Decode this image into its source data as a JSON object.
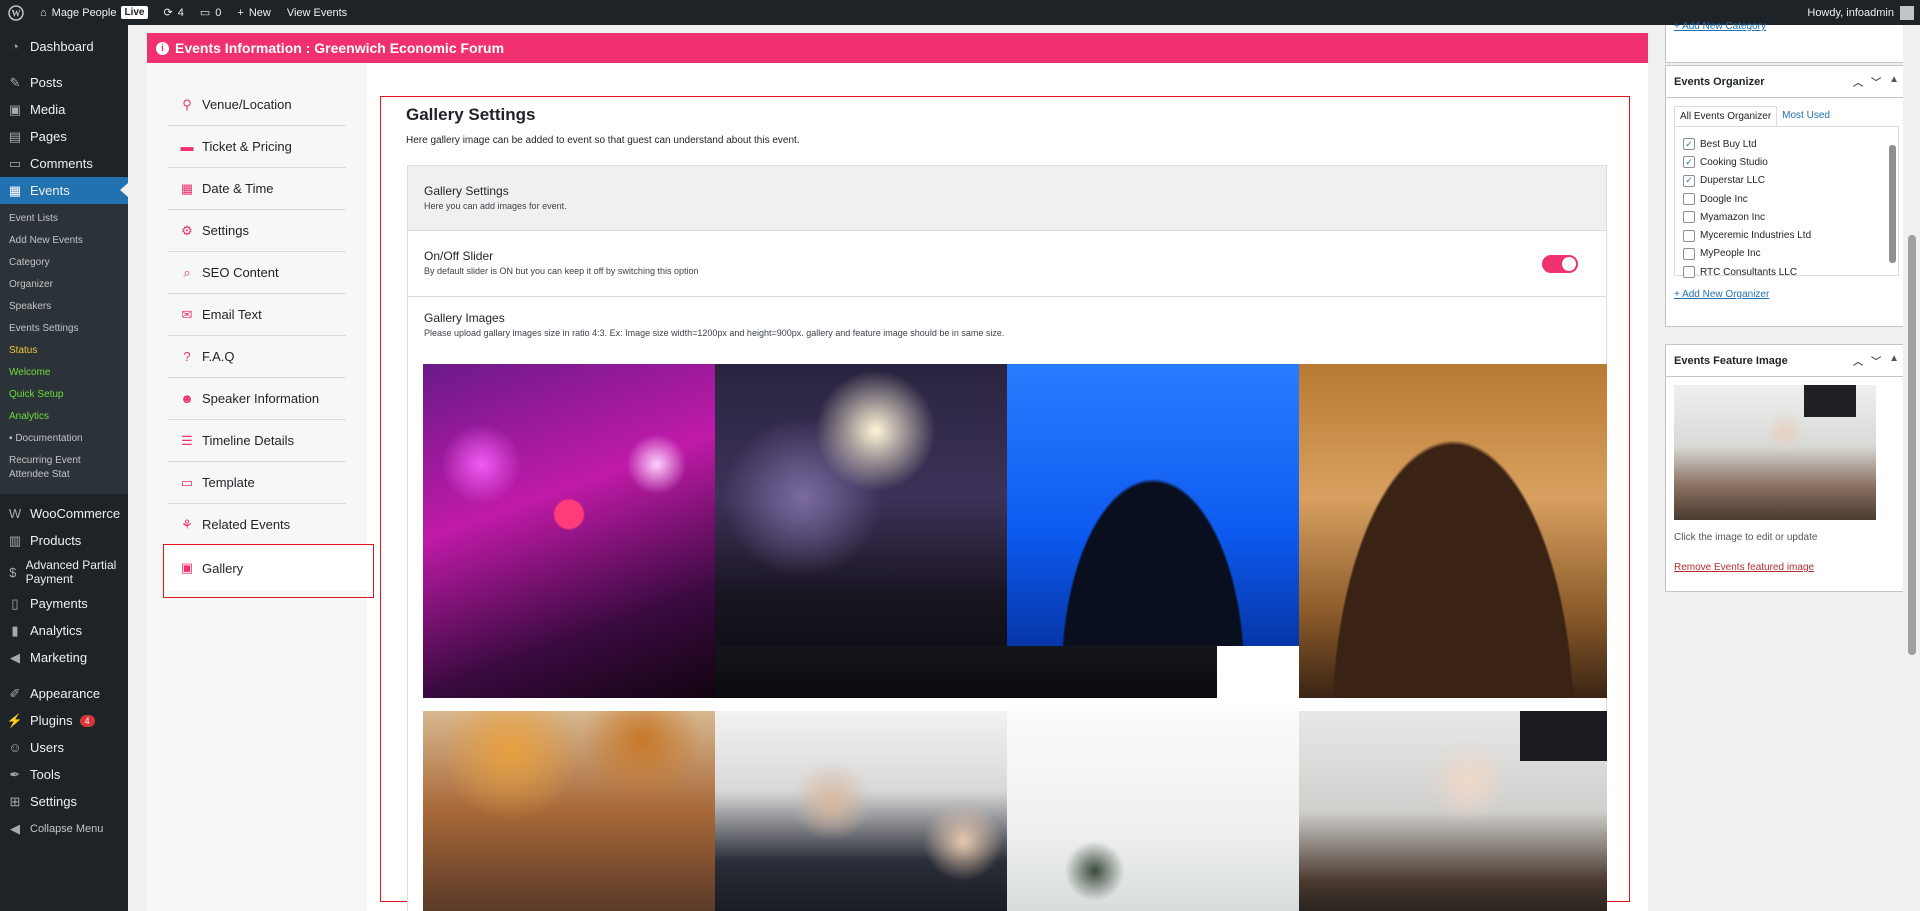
{
  "admin_bar": {
    "site_name": "Mage People",
    "live_badge": "Live",
    "updates_count": "4",
    "comments_count": "0",
    "new_label": "New",
    "view_events_label": "View Events",
    "howdy": "Howdy, infoadmin"
  },
  "sidebar": {
    "items": [
      {
        "label": "Dashboard",
        "icon": "dashboard-icon"
      },
      {
        "label": "Posts",
        "icon": "pin-icon"
      },
      {
        "label": "Media",
        "icon": "media-icon"
      },
      {
        "label": "Pages",
        "icon": "pages-icon"
      },
      {
        "label": "Comments",
        "icon": "comment-icon"
      },
      {
        "label": "Events",
        "icon": "calendar-icon"
      }
    ],
    "events_submenu": [
      "Event Lists",
      "Add New Events",
      "Category",
      "Organizer",
      "Speakers",
      "Events Settings",
      "Status",
      "Welcome",
      "Quick Setup",
      "Analytics",
      "Documentation",
      "Recurring Event Attendee Stat"
    ],
    "items2": [
      {
        "label": "WooCommerce"
      },
      {
        "label": "Products"
      },
      {
        "label": "Advanced Partial Payment"
      },
      {
        "label": "Payments"
      },
      {
        "label": "Analytics"
      },
      {
        "label": "Marketing"
      },
      {
        "label": "Appearance"
      },
      {
        "label": "Plugins",
        "badge": "4"
      },
      {
        "label": "Users"
      },
      {
        "label": "Tools"
      },
      {
        "label": "Settings"
      },
      {
        "label": "Collapse Menu"
      }
    ]
  },
  "header": {
    "title": "Events Information : Greenwich Economic Forum"
  },
  "tabs": [
    {
      "label": "Venue/Location"
    },
    {
      "label": "Ticket & Pricing"
    },
    {
      "label": "Date & Time"
    },
    {
      "label": "Settings"
    },
    {
      "label": "SEO Content"
    },
    {
      "label": "Email Text"
    },
    {
      "label": "F.A.Q"
    },
    {
      "label": "Speaker Information"
    },
    {
      "label": "Timeline Details"
    },
    {
      "label": "Template"
    },
    {
      "label": "Related Events"
    },
    {
      "label": "Gallery"
    }
  ],
  "gallery": {
    "title": "Gallery Settings",
    "description": "Here gallery image can be added to event so that guest can understand about this event.",
    "section_title": "Gallery Settings",
    "section_subtitle": "Here you can add images for event.",
    "slider_title": "On/Off Slider",
    "slider_subtitle": "By default slider is ON but you can keep it off by switching this option",
    "slider_on": true,
    "images_title": "Gallery Images",
    "images_subtitle": "Please upload gallary images size in ratio 4:3. Ex: Image size width=1200px and height=900px. gallery and feature image should be in same size."
  },
  "organizer_box": {
    "title": "Events Organizer",
    "tab_all": "All Events Organizer",
    "tab_used": "Most Used",
    "orgs": [
      {
        "name": "Best Buy Ltd",
        "checked": true
      },
      {
        "name": "Cooking Studio",
        "checked": true
      },
      {
        "name": "Duperstar LLC",
        "checked": true
      },
      {
        "name": "Doogle Inc",
        "checked": false
      },
      {
        "name": "Myamazon Inc",
        "checked": false
      },
      {
        "name": "Myceremic Industries Ltd",
        "checked": false
      },
      {
        "name": "MyPeople Inc",
        "checked": false
      },
      {
        "name": "RTC Consultants LLC",
        "checked": false
      }
    ],
    "add_link": "+ Add New Organizer"
  },
  "feature_box": {
    "title": "Events Feature Image",
    "hint": "Click the image to edit or update",
    "remove_link": "Remove Events featured image"
  },
  "top_link": "+ Add New Category",
  "colors": {
    "accent": "#f0306f",
    "wp_blue": "#2271b1",
    "admin_dark": "#1d2327"
  }
}
